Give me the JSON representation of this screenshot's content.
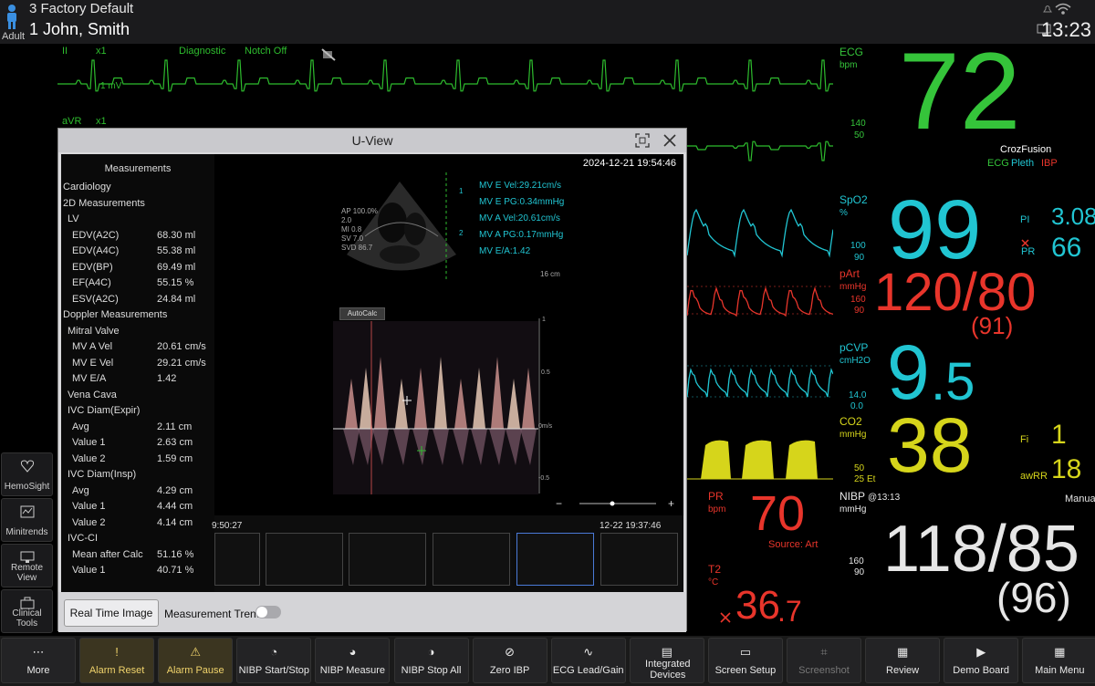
{
  "topbar": {
    "patient_type": "Adult",
    "bed_profile": "3 Factory Default",
    "patient_name": "1 John, Smith",
    "time": "13:23"
  },
  "sidebar": [
    {
      "label": "HemoSight",
      "icon": "heart-icon"
    },
    {
      "label": "Minitrends",
      "icon": "trend-icon"
    },
    {
      "label": "Remote View",
      "icon": "monitor-icon"
    },
    {
      "label": "Clinical Tools",
      "icon": "toolbox-icon"
    }
  ],
  "waves": {
    "lead1": "II",
    "gain1": "x1",
    "mode": "Diagnostic",
    "notch": "Notch Off",
    "scale": "1 mV",
    "lead2": "aVR",
    "gain2": "x1"
  },
  "params": {
    "ecg": {
      "label": "ECG",
      "unit": "bpm",
      "value": "72",
      "hi": "140",
      "lo": "50",
      "fusion": "CrozFusion",
      "sources": [
        "ECG",
        "Pleth",
        "IBP"
      ]
    },
    "spo2": {
      "label": "SpO2",
      "unit": "%",
      "value": "99",
      "hi": "100",
      "lo": "90",
      "pi_label": "PI",
      "pi": "3.08",
      "pr_label": "PR",
      "pr": "66"
    },
    "part": {
      "label": "pArt",
      "unit": "mmHg",
      "value": "120/80",
      "mean": "(91)",
      "hi": "160",
      "lo": "90"
    },
    "pcvp": {
      "label": "pCVP",
      "unit": "cmH2O",
      "value_int": "9",
      "value_dec": ".5",
      "hi": "14.0",
      "lo": "0.0"
    },
    "co2": {
      "label": "CO2",
      "unit": "mmHg",
      "value": "38",
      "hi": "50",
      "lo": "25",
      "et": "Et",
      "fi_label": "Fi",
      "fi": "1",
      "awrr_label": "awRR",
      "awrr": "18"
    },
    "pr": {
      "label": "PR",
      "unit": "bpm",
      "value": "70",
      "source": "Source: Art"
    },
    "t2": {
      "label": "T2",
      "unit": "°C",
      "value_int": "36",
      "value_dec": ".7"
    },
    "nibp": {
      "label": "NIBP",
      "unit": "mmHg",
      "time": "@13:13",
      "mode": "Manual",
      "value": "118/85",
      "mean": "(96)",
      "hi": "160",
      "lo": "90"
    }
  },
  "dialog": {
    "title": "U-View",
    "datetime": "2024-12-21    19:54:46",
    "panel_title": "Measurements",
    "rows": [
      {
        "label": "Cardiology",
        "value": ""
      },
      {
        "label": "2D Measurements",
        "value": ""
      },
      {
        "label": "LV",
        "value": ""
      },
      {
        "label": "EDV(A2C)",
        "value": "68.30 ml"
      },
      {
        "label": "EDV(A4C)",
        "value": "55.38 ml"
      },
      {
        "label": "EDV(BP)",
        "value": "69.49 ml"
      },
      {
        "label": "EF(A4C)",
        "value": "55.15 %"
      },
      {
        "label": "ESV(A2C)",
        "value": "24.84 ml"
      },
      {
        "label": "Doppler Measurements",
        "value": ""
      },
      {
        "label": "Mitral Valve",
        "value": ""
      },
      {
        "label": "MV A Vel",
        "value": "20.61 cm/s"
      },
      {
        "label": "MV E Vel",
        "value": "29.21 cm/s"
      },
      {
        "label": "MV E/A",
        "value": "1.42"
      },
      {
        "label": "Vena Cava",
        "value": ""
      },
      {
        "label": "IVC Diam(Expir)",
        "value": ""
      },
      {
        "label": "Avg",
        "value": "2.11 cm"
      },
      {
        "label": "Value 1",
        "value": "2.63 cm"
      },
      {
        "label": "Value 2",
        "value": "1.59 cm"
      },
      {
        "label": "IVC Diam(Insp)",
        "value": ""
      },
      {
        "label": "Avg",
        "value": "4.29 cm"
      },
      {
        "label": "Value 1",
        "value": "4.44 cm"
      },
      {
        "label": "Value 2",
        "value": "4.14 cm"
      },
      {
        "label": "IVC-CI",
        "value": ""
      },
      {
        "label": "Mean after Calc",
        "value": "51.16 %"
      },
      {
        "label": "Value 1",
        "value": "40.71 %"
      }
    ],
    "echo_params": [
      "AP 100.0%",
      "2.0",
      "MI 0.8",
      "SV 7.0",
      "SVD 86.7"
    ],
    "depth": "16 cm",
    "overlay": [
      "MV E Vel:29.21cm/s",
      "MV E PG:0.34mmHg",
      "MV A Vel:20.61cm/s",
      "MV A PG:0.17mmHg",
      "MV E/A:1.42"
    ],
    "autocalc": "AutoCalc",
    "doppler_scale": [
      "1",
      "0.5",
      "0m/s",
      "-0.5"
    ],
    "thumb_left_time": "9:50:27",
    "thumb_right_time": "12-22 19:37:46",
    "realtime_button": "Real Time Image",
    "trend_label": "Measurement Trend:"
  },
  "toolbar": [
    {
      "label": "More",
      "icon": "more-icon"
    },
    {
      "label": "Alarm Reset",
      "icon": "alarm-reset-icon"
    },
    {
      "label": "Alarm Pause",
      "icon": "alarm-pause-icon"
    },
    {
      "label": "NIBP Start/Stop",
      "icon": "nibp-icon"
    },
    {
      "label": "NIBP Measure",
      "icon": "nibp-measure-icon"
    },
    {
      "label": "NIBP Stop All",
      "icon": "nibp-stop-icon"
    },
    {
      "label": "Zero IBP",
      "icon": "zero-icon"
    },
    {
      "label": "ECG Lead/Gain",
      "icon": "ecg-icon"
    },
    {
      "label": "Integrated Devices",
      "icon": "devices-icon"
    },
    {
      "label": "Screen Setup",
      "icon": "screen-icon"
    },
    {
      "label": "Screenshot",
      "icon": "screenshot-icon"
    },
    {
      "label": "Review",
      "icon": "review-icon"
    },
    {
      "label": "Demo Board",
      "icon": "demo-icon"
    },
    {
      "label": "Main Menu",
      "icon": "menu-icon"
    }
  ]
}
